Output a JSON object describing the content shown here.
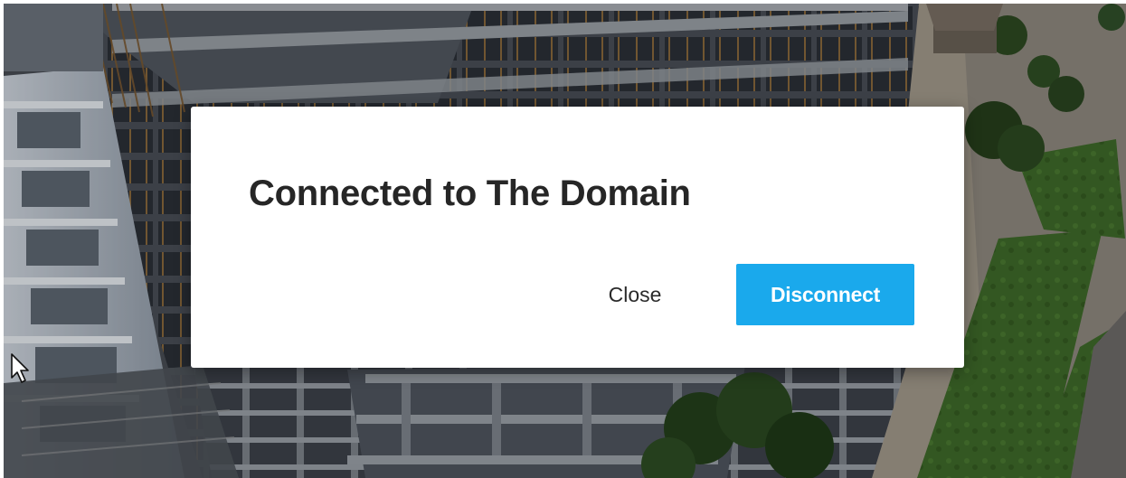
{
  "dialog": {
    "title": "Connected to The Domain",
    "close_label": "Close",
    "disconnect_label": "Disconnect"
  },
  "colors": {
    "accent": "#1aa9ec",
    "dialog_background": "#ffffff",
    "title_text": "#262626"
  },
  "icons": {
    "cursor": "mouse-pointer-icon"
  }
}
